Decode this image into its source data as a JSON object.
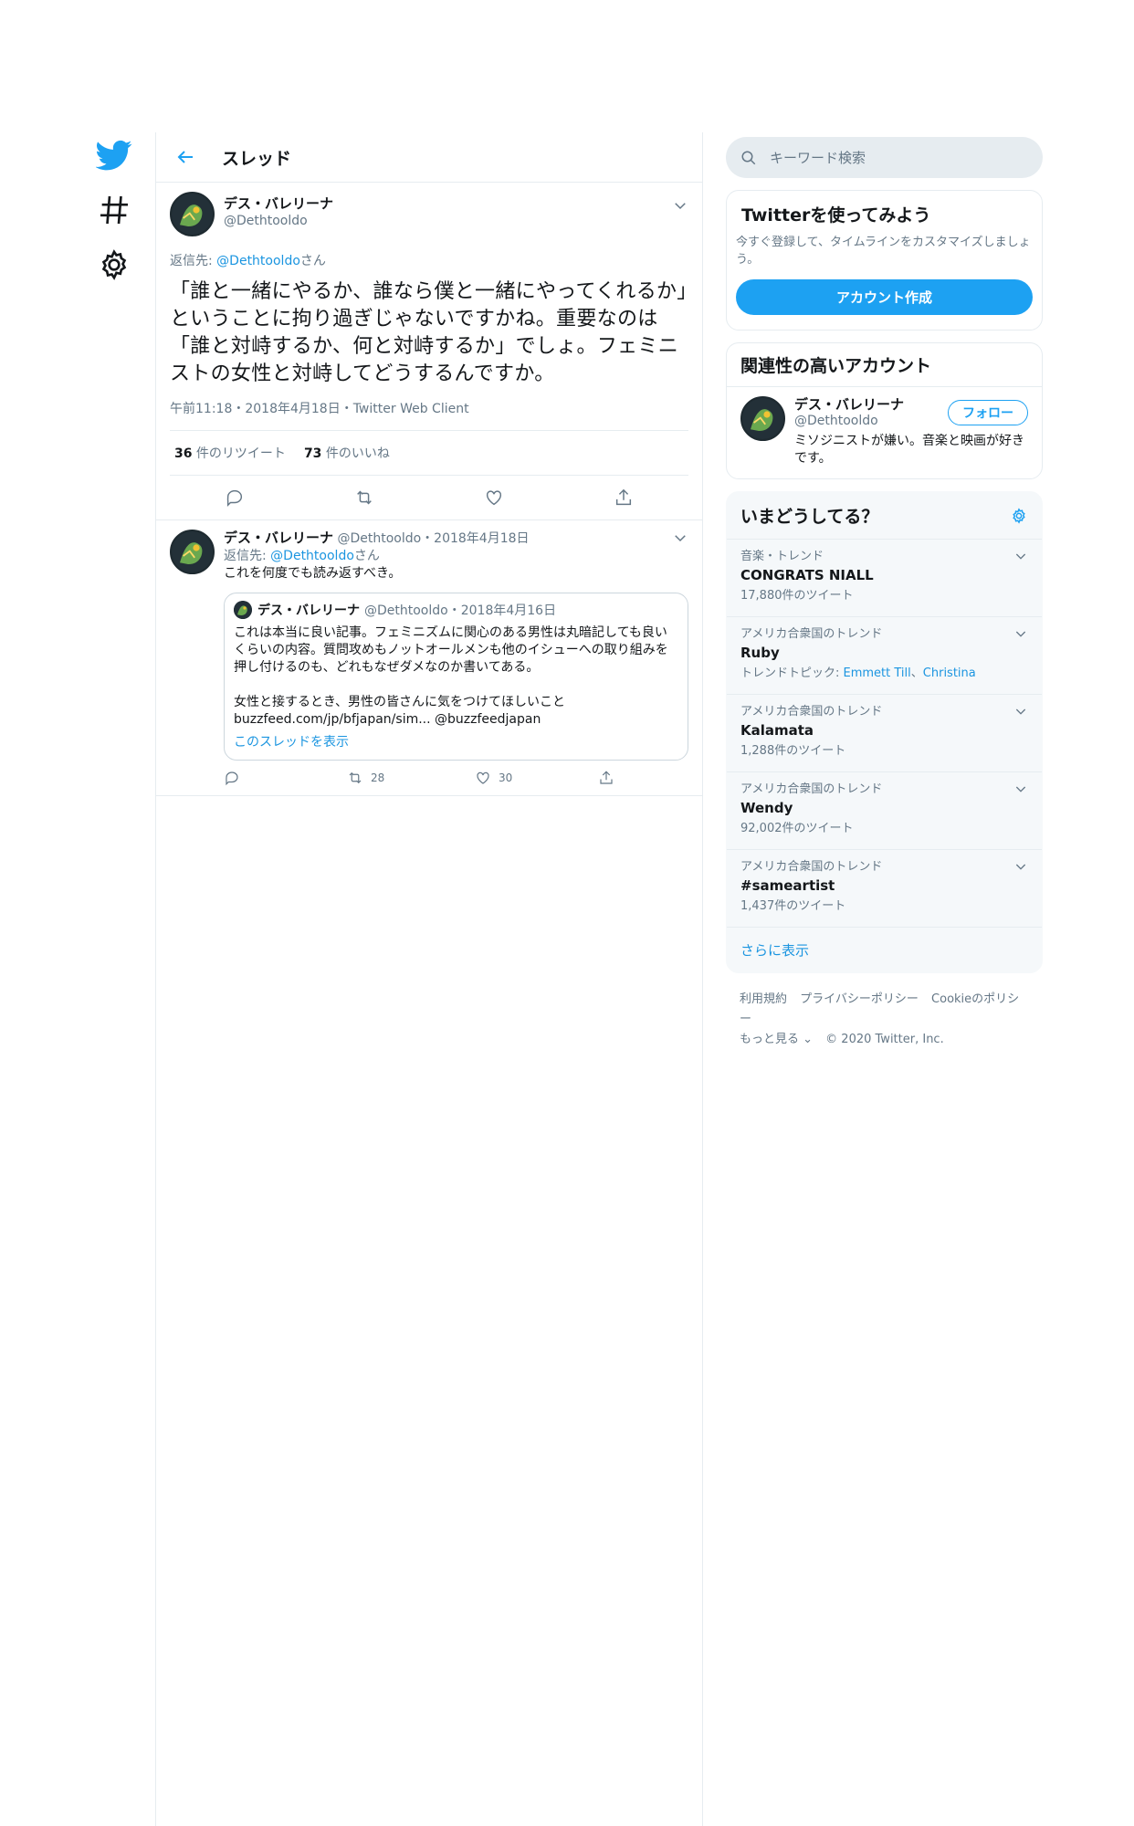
{
  "nav": {
    "icons": [
      "twitter-logo-icon",
      "hashtag-icon",
      "settings-gear-icon"
    ]
  },
  "header": {
    "title": "スレッド"
  },
  "main_tweet": {
    "name": "デス・バレリーナ",
    "handle": "@Dethtooldo",
    "reply_prefix": "返信先: ",
    "reply_to": "@Dethtooldo",
    "reply_suffix": "さん",
    "text": "「誰と一緒にやるか、誰なら僕と一緒にやってくれるか」ということに拘り過ぎじゃないですかね。重要なのは「誰と対峙するか、何と対峙するか」でしょ。フェミニストの女性と対峙してどうするんですか。",
    "meta": "午前11:18・2018年4月18日・Twitter Web Client",
    "retweets_count": "36",
    "retweets_label": " 件のリツイート",
    "likes_count": "73",
    "likes_label": " 件のいいね"
  },
  "reply_tweet": {
    "name": "デス・バレリーナ",
    "handle_date": " @Dethtooldo・2018年4月18日",
    "reply_prefix": "返信先: ",
    "reply_to": "@Dethtooldo",
    "reply_suffix": "さん",
    "text": "これを何度でも読み返すべき。",
    "quote": {
      "name": "デス・バレリーナ",
      "handle_date": "@Dethtooldo・2018年4月16日",
      "text": "これは本当に良い記事。フェミニズムに関心のある男性は丸暗記しても良いくらいの内容。質問攻めもノットオールメンも他のイシューへの取り組みを押し付けるのも、どれもなぜダメなのか書いてある。\n\n女性と接するとき、男性の皆さんに気をつけてほしいこと\nbuzzfeed.com/jp/bfjapan/sim... @buzzfeedjapan",
      "show_thread": "このスレッドを表示"
    },
    "retweets": "28",
    "likes": "30"
  },
  "sidebar": {
    "search_placeholder": "キーワード検索",
    "signup_title": "Twitterを使ってみよう",
    "signup_sub": "今すぐ登録して、タイムラインをカスタマイズしましょう。",
    "signup_button": "アカウント作成",
    "related_title": "関連性の高いアカウント",
    "related": {
      "name": "デス・バレリーナ",
      "handle": "@Dethtooldo",
      "bio": "ミソジニストが嫌い。音楽と映画が好きです。",
      "follow": "フォロー"
    },
    "trends_title": "いまどうしてる？",
    "trends": [
      {
        "ctx": "音楽・トレンド",
        "name": "CONGRATS NIALL",
        "count": "17,880件のツイート"
      },
      {
        "ctx": "アメリカ合衆国のトレンド",
        "name": "Ruby",
        "topics_label": "トレンドトピック: ",
        "topic1": "Emmett Till",
        "sep": "、",
        "topic2": "Christina"
      },
      {
        "ctx": "アメリカ合衆国のトレンド",
        "name": "Kalamata",
        "count": "1,288件のツイート"
      },
      {
        "ctx": "アメリカ合衆国のトレンド",
        "name": "Wendy",
        "count": "92,002件のツイート"
      },
      {
        "ctx": "アメリカ合衆国のトレンド",
        "name": "#sameartist",
        "count": "1,437件のツイート"
      }
    ],
    "show_more": "さらに表示",
    "footer": {
      "terms": "利用規約",
      "privacy": "プライバシーポリシー",
      "cookies": "Cookieのポリシー",
      "more": "もっと見る ⌄",
      "copyright": "© 2020 Twitter, Inc."
    }
  }
}
